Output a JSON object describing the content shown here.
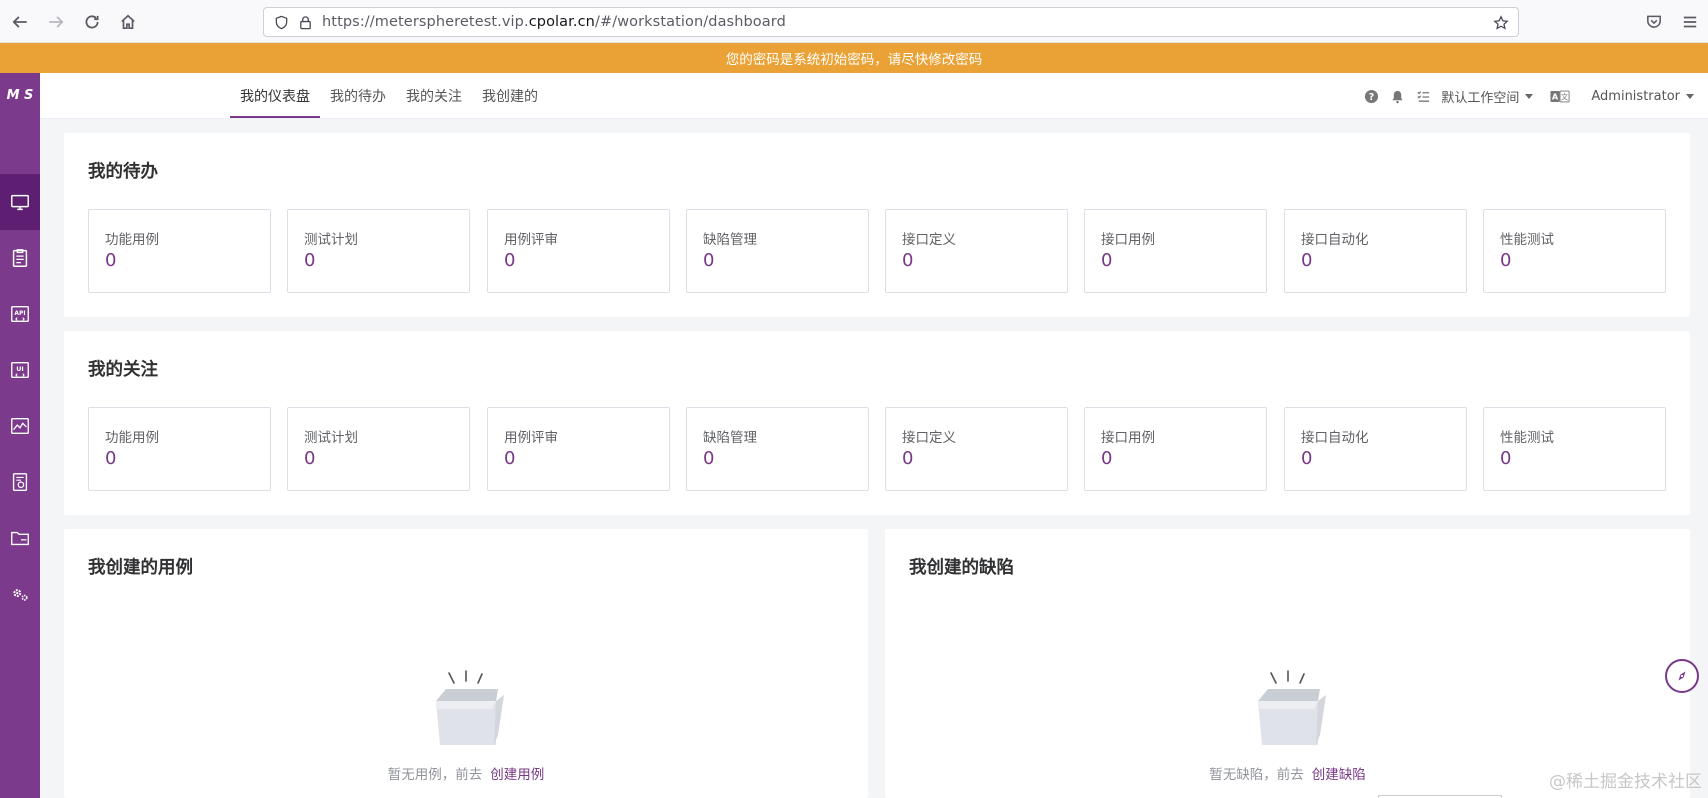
{
  "browser": {
    "url_prefix": "https://meterspheretest.vip.",
    "url_host": "cpolar.cn",
    "url_suffix": "/#/workstation/dashboard"
  },
  "banner": {
    "text": "您的密码是系统初始密码，请尽快修改密码"
  },
  "sidebar": {
    "logo": "M S",
    "items": [
      {
        "icon": "workstation-icon",
        "active": true
      },
      {
        "icon": "track-icon"
      },
      {
        "icon": "api-icon"
      },
      {
        "icon": "ui-icon"
      },
      {
        "icon": "performance-icon"
      },
      {
        "icon": "report-icon"
      },
      {
        "icon": "project-icon"
      },
      {
        "icon": "settings-icon"
      }
    ]
  },
  "header": {
    "tabs": [
      {
        "label": "我的仪表盘",
        "active": true
      },
      {
        "label": "我的待办"
      },
      {
        "label": "我的关注"
      },
      {
        "label": "我创建的"
      }
    ],
    "workspace": "默认工作空间",
    "user": "Administrator"
  },
  "todo": {
    "title": "我的待办",
    "cards": [
      {
        "label": "功能用例",
        "count": "0"
      },
      {
        "label": "测试计划",
        "count": "0"
      },
      {
        "label": "用例评审",
        "count": "0"
      },
      {
        "label": "缺陷管理",
        "count": "0"
      },
      {
        "label": "接口定义",
        "count": "0"
      },
      {
        "label": "接口用例",
        "count": "0"
      },
      {
        "label": "接口自动化",
        "count": "0"
      },
      {
        "label": "性能测试",
        "count": "0"
      }
    ]
  },
  "follow": {
    "title": "我的关注",
    "cards": [
      {
        "label": "功能用例",
        "count": "0"
      },
      {
        "label": "测试计划",
        "count": "0"
      },
      {
        "label": "用例评审",
        "count": "0"
      },
      {
        "label": "缺陷管理",
        "count": "0"
      },
      {
        "label": "接口定义",
        "count": "0"
      },
      {
        "label": "接口用例",
        "count": "0"
      },
      {
        "label": "接口自动化",
        "count": "0"
      },
      {
        "label": "性能测试",
        "count": "0"
      }
    ]
  },
  "created_cases": {
    "title": "我创建的用例",
    "empty_text": "暂无用例，前去",
    "link": "创建用例"
  },
  "created_bugs": {
    "title": "我创建的缺陷",
    "empty_text": "暂无缺陷，前去",
    "link": "创建缺陷"
  },
  "watermark": "@稀土掘金技术社区"
}
